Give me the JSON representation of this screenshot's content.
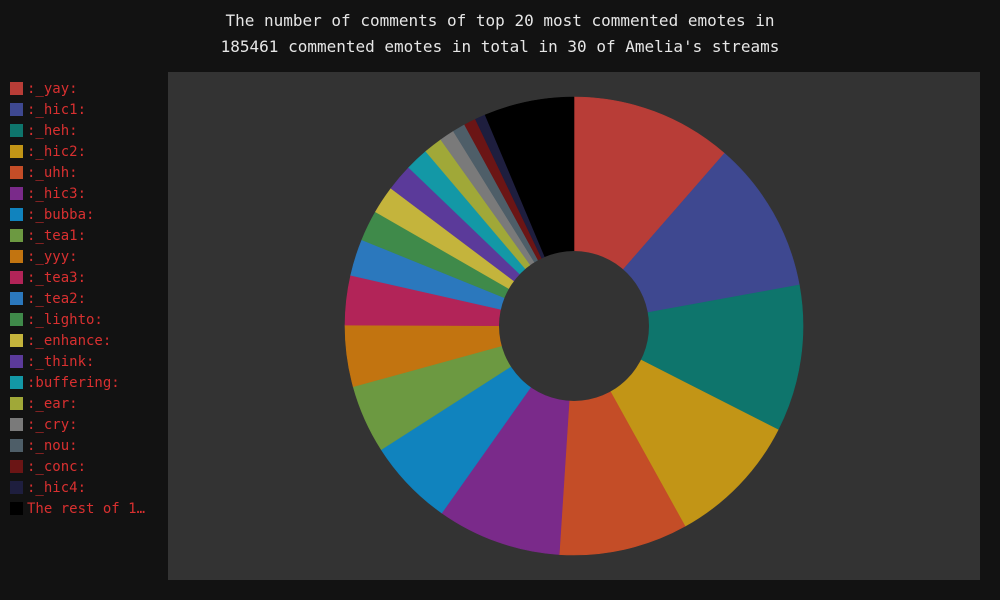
{
  "chart_data": {
    "type": "pie",
    "title_lines": [
      "The number of comments of top 20 most commented emotes in",
      "185461 commented emotes in total in 30 of Amelia's streams"
    ],
    "donut": true,
    "legend_position": "left",
    "slices": [
      {
        "label": ":_yay:",
        "value": 21600,
        "color": "#b83d37"
      },
      {
        "label": ":_hic1:",
        "value": 20300,
        "color": "#3e4890"
      },
      {
        "label": ":_heh:",
        "value": 19600,
        "color": "#0e756c"
      },
      {
        "label": ":_hic2:",
        "value": 17900,
        "color": "#c29516"
      },
      {
        "label": ":_uhh:",
        "value": 17200,
        "color": "#c44d27"
      },
      {
        "label": ":_hic3:",
        "value": 16600,
        "color": "#7a2a8a"
      },
      {
        "label": ":_bubba:",
        "value": 11600,
        "color": "#1083be"
      },
      {
        "label": ":_tea1:",
        "value": 9100,
        "color": "#6c9941"
      },
      {
        "label": ":_yyy:",
        "value": 8200,
        "color": "#c27410"
      },
      {
        "label": ":_tea3:",
        "value": 6600,
        "color": "#b22458"
      },
      {
        "label": ":_tea2:",
        "value": 4900,
        "color": "#2b78bd"
      },
      {
        "label": ":_lighto:",
        "value": 4100,
        "color": "#3f8a4a"
      },
      {
        "label": ":_enhance:",
        "value": 3700,
        "color": "#c4b43c"
      },
      {
        "label": ":_think:",
        "value": 3600,
        "color": "#5b3a9a"
      },
      {
        "label": ":buffering:",
        "value": 3100,
        "color": "#1398a6"
      },
      {
        "label": ":_ear:",
        "value": 2500,
        "color": "#a0a838"
      },
      {
        "label": ":_cry:",
        "value": 2000,
        "color": "#7a7a7a"
      },
      {
        "label": ":_nou:",
        "value": 1700,
        "color": "#4e5e68"
      },
      {
        "label": ":_conc:",
        "value": 1600,
        "color": "#6b1515"
      },
      {
        "label": ":_hic4:",
        "value": 1400,
        "color": "#1e1e3e"
      },
      {
        "label": "The rest of 12…",
        "value": 12000,
        "color": "#000000"
      }
    ]
  }
}
